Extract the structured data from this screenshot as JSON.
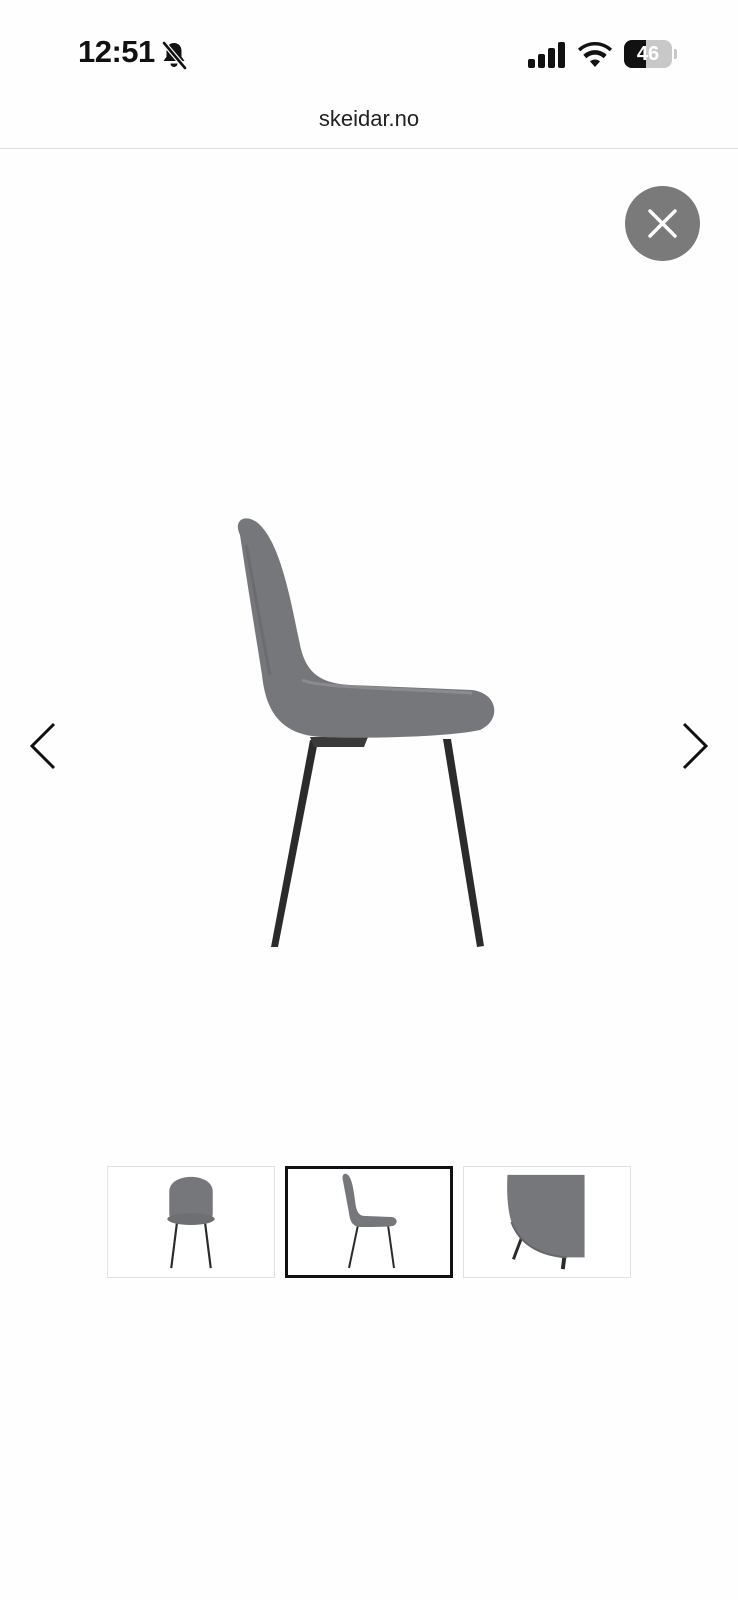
{
  "status_bar": {
    "time": "12:51",
    "battery_level": "46",
    "battery_percent": 46,
    "icons": [
      "bell-slash-icon",
      "cellular-signal-icon",
      "wifi-icon",
      "battery-icon"
    ]
  },
  "browser": {
    "url": "skeidar.no"
  },
  "gallery": {
    "close_icon": "close-icon",
    "prev_icon": "chevron-left-icon",
    "next_icon": "chevron-right-icon",
    "main_image": "grey-dining-chair-side-view",
    "selected_thumbnail": 2,
    "thumbnails": [
      {
        "image": "grey-dining-chair-front-view"
      },
      {
        "image": "grey-dining-chair-side-view"
      },
      {
        "image": "grey-dining-chair-detail-view"
      }
    ]
  },
  "colors": {
    "upholstery": "#76777b",
    "legs": "#2b2b2b",
    "close_button": "#7a7a7a",
    "selected_border": "#111111",
    "thumbnail_border": "#e2e2e2"
  }
}
